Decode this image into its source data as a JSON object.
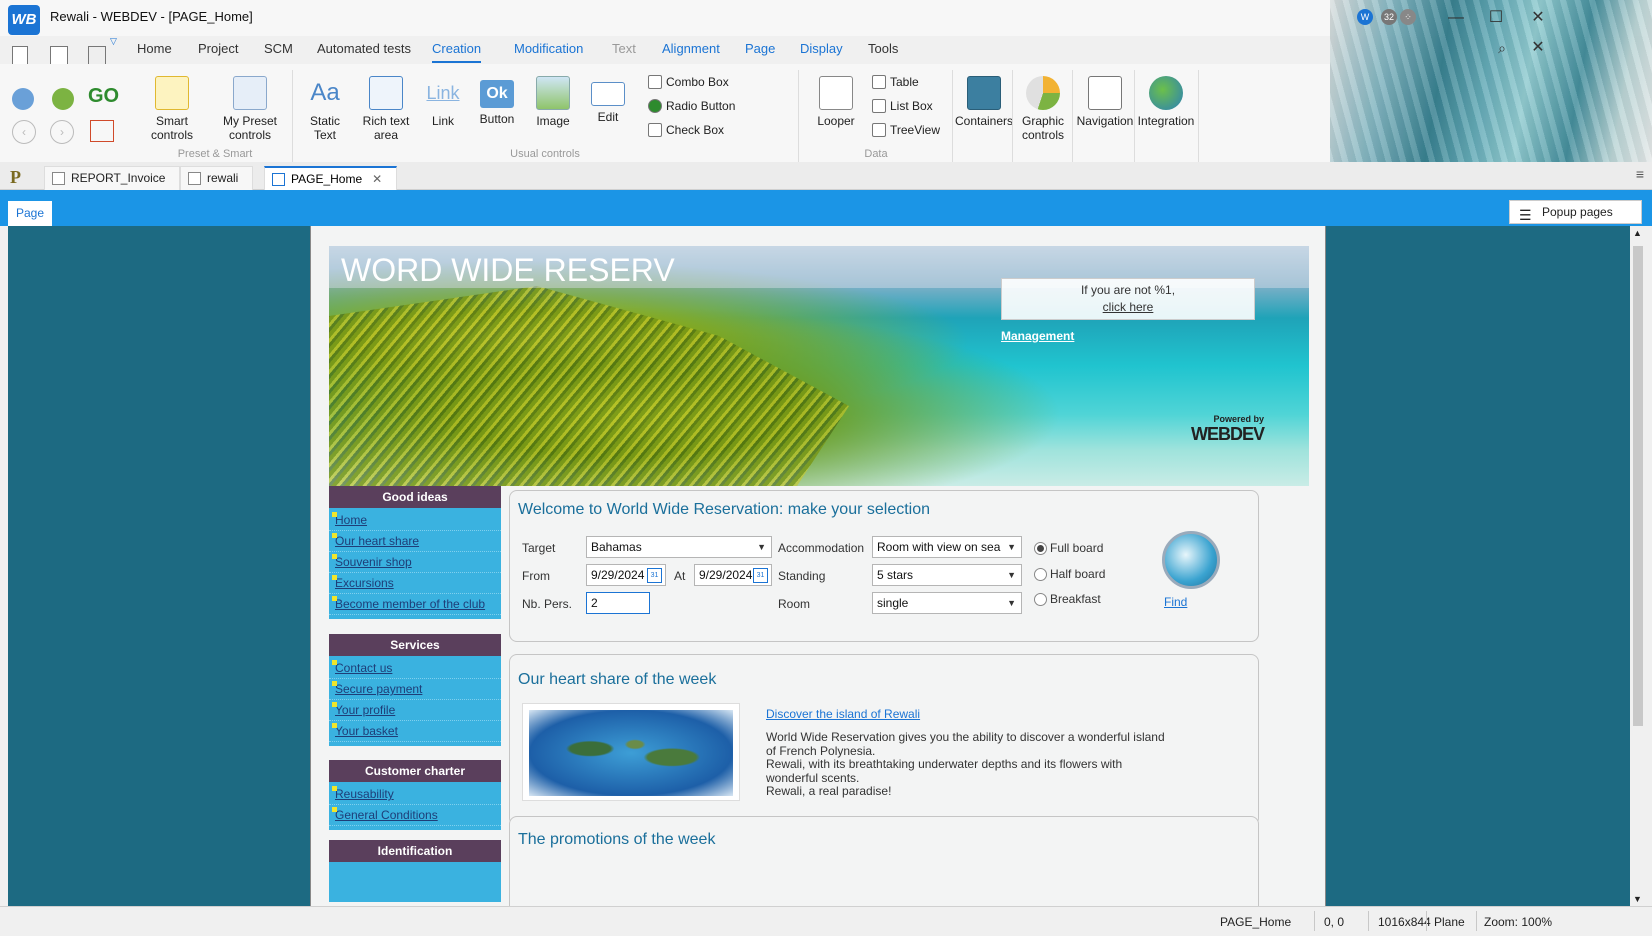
{
  "window": {
    "logo": "WB",
    "title": "Rewali - WEBDEV - [PAGE_Home]",
    "badge_count": "32"
  },
  "ribbon_tabs": [
    "Home",
    "Project",
    "SCM",
    "Automated tests",
    "Creation",
    "Modification",
    "Text",
    "Alignment",
    "Page",
    "Display",
    "Tools"
  ],
  "ribbon": {
    "smart_controls": "Smart controls",
    "my_preset_controls": "My Preset controls",
    "group_preset": "Preset & Smart",
    "static_text": "Static Text",
    "rich_text_area": "Rich text area",
    "link": "Link",
    "button": "Button",
    "image": "Image",
    "edit": "Edit",
    "combo_box": "Combo Box",
    "radio_button": "Radio Button",
    "check_box": "Check Box",
    "group_usual": "Usual controls",
    "looper": "Looper",
    "table": "Table",
    "list_box": "List Box",
    "treeview": "TreeView",
    "group_data": "Data",
    "containers": "Containers",
    "graphic_controls": "Graphic controls",
    "navigation": "Navigation",
    "integration": "Integration",
    "static_icon_text": "Aa",
    "link_icon_text": "Link",
    "button_icon_text": "Ok",
    "go_icon_text": "GO"
  },
  "doc_tabs": [
    "P",
    "REPORT_Invoice",
    "rewali",
    "PAGE_Home"
  ],
  "page_strip": {
    "page_tab": "Page",
    "popup_pages": "Popup pages"
  },
  "banner": {
    "title": "WORD WIDE RESERV",
    "login_line1": "If you are not %1,",
    "login_line2": "click here",
    "management": "Management",
    "powered_by": "Powered by",
    "webdev": "WEBDEV"
  },
  "menus": [
    {
      "title": "Good ideas",
      "links": [
        "Home",
        "Our heart share",
        "Souvenir shop",
        "Excursions",
        "Become member of the club"
      ]
    },
    {
      "title": "Services",
      "links": [
        "Contact us",
        "Secure payment",
        "Your profile",
        "Your basket"
      ]
    },
    {
      "title": "Customer charter",
      "links": [
        "Reusability",
        "General Conditions"
      ]
    },
    {
      "title": "Identification",
      "links": []
    }
  ],
  "selection": {
    "title": "Welcome to World Wide Reservation: make your selection",
    "target_label": "Target",
    "target_value": "Bahamas",
    "from_label": "From",
    "from_value": "9/29/2024",
    "at_label": "At",
    "at_value": "9/29/2024",
    "persons_label": "Nb. Pers.",
    "persons_value": "2",
    "accommodation_label": "Accommodation",
    "accommodation_value": "Room with view on sea",
    "standing_label": "Standing",
    "standing_value": "5 stars",
    "room_label": "Room",
    "room_value": "single",
    "board_options": [
      "Full board",
      "Half board",
      "Breakfast"
    ],
    "board_selected": "Full board",
    "find": "Find",
    "calendar_glyph": "31"
  },
  "heart_share": {
    "title": "Our heart share of the week",
    "link": "Discover the island of Rewali",
    "text1": "World Wide Reservation gives you the ability to discover a wonderful island of French Polynesia.",
    "text2": "Rewali, with its breathtaking underwater depths and its flowers with wonderful scents.",
    "text3": "Rewali, a real paradise!"
  },
  "promotions": {
    "title": "The promotions of the week"
  },
  "status_bar": {
    "page": "PAGE_Home",
    "coords": "0, 0",
    "size": "1016x844",
    "plane": "Plane",
    "zoom": "Zoom: 100%"
  },
  "colors": {
    "accent": "#1b74d4",
    "page_strip": "#1b95e6",
    "editor_bg": "#1d6a82",
    "menu_head": "#5a3f5c",
    "menu_body": "#3ab2e0",
    "panel_title": "#1a6f9b"
  }
}
